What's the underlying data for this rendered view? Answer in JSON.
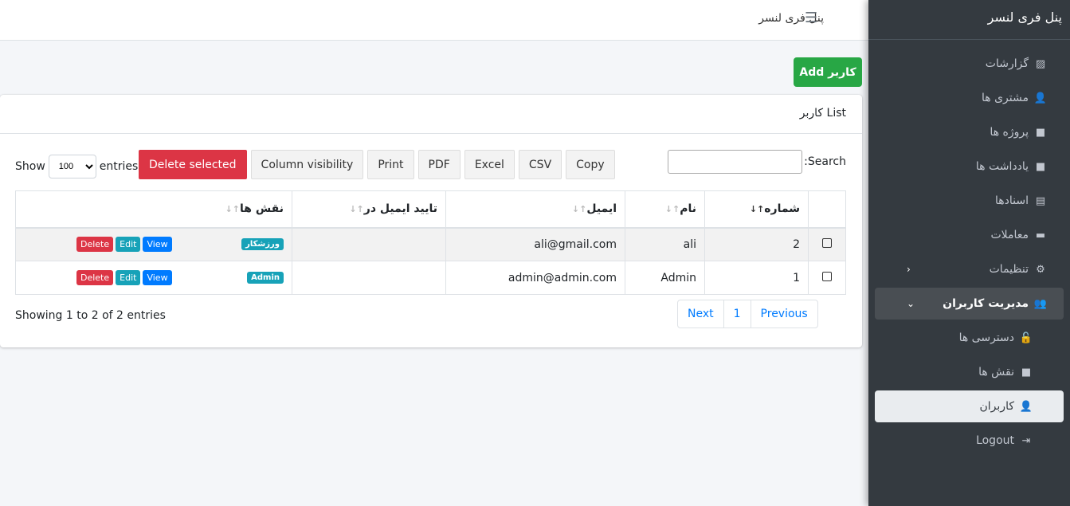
{
  "header": {
    "brand": "پنل فری لنسر"
  },
  "sidebar": {
    "title": "پنل فری لنسر",
    "items": [
      {
        "label": "گزارشات",
        "icon": "chart-icon"
      },
      {
        "label": "مشتری ها",
        "icon": "user-plus-icon"
      },
      {
        "label": "پروژه ها",
        "icon": "briefcase-icon"
      },
      {
        "label": "یادداشت ها",
        "icon": "sticky-note-icon"
      },
      {
        "label": "اسنادها",
        "icon": "file-icon"
      },
      {
        "label": "معاملات",
        "icon": "credit-card-icon"
      },
      {
        "label": "تنظیمات",
        "icon": "gear-icon"
      },
      {
        "label": "مدیریت کاربران",
        "icon": "users-icon"
      },
      {
        "label": "دسترسی ها",
        "icon": "unlock-icon"
      },
      {
        "label": "نقش ها",
        "icon": "briefcase-icon"
      },
      {
        "label": "کاربران",
        "icon": "user-icon"
      },
      {
        "label": "Logout",
        "icon": "sign-out-icon"
      }
    ]
  },
  "add_button": "Add کاربر",
  "card": {
    "title": "کاربر List"
  },
  "length": {
    "show": "Show",
    "value": "100",
    "entries": "entries"
  },
  "toolbar": {
    "delete_selected": "Delete selected",
    "column_visibility": "Column visibility",
    "print": "Print",
    "pdf": "PDF",
    "excel": "Excel",
    "csv": "CSV",
    "copy": "Copy"
  },
  "search": {
    "label": "Search:",
    "value": ""
  },
  "table": {
    "headers": [
      "شماره",
      "نام",
      "ایمیل",
      "تایید ایمیل در",
      "نقش ها"
    ],
    "rows": [
      {
        "id": "2",
        "name": "ali",
        "email": "ali@gmail.com",
        "verified": "",
        "role": "ورزشکار"
      },
      {
        "id": "1",
        "name": "Admin",
        "email": "admin@admin.com",
        "verified": "",
        "role": "Admin"
      }
    ],
    "actions": {
      "view": "View",
      "edit": "Edit",
      "delete": "Delete"
    }
  },
  "footer": {
    "info": "Showing 1 to 2 of 2 entries",
    "next": "Next",
    "page": "1",
    "previous": "Previous"
  },
  "colors": {
    "sidebar": "#343a40",
    "success": "#28a745",
    "danger": "#dc3545",
    "info": "#17a2b8",
    "primary": "#007bff"
  }
}
